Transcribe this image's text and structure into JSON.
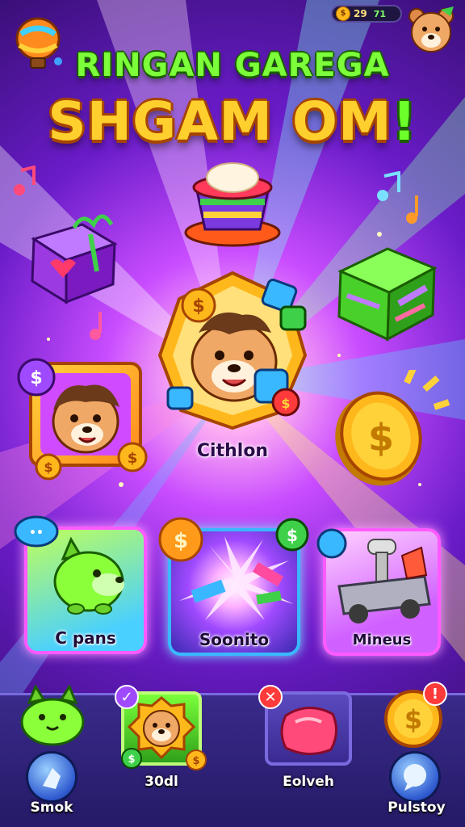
{
  "hud": {
    "coins": "29",
    "gems": "71"
  },
  "title": {
    "line1": "RINGAN GAREGA",
    "line2": "SHGAM OM",
    "line2_end": "!"
  },
  "hero": {
    "label": "Cithlon"
  },
  "cards": [
    {
      "label": "C pans"
    },
    {
      "label": "Soonito"
    },
    {
      "label": "Mineus"
    }
  ],
  "bottom_nav": [
    {
      "label": "Smok"
    },
    {
      "label": "30dl"
    },
    {
      "label": "Eolveh"
    },
    {
      "label": "Pulstoy"
    }
  ],
  "colors": {
    "bg_deep": "#2a0b5e",
    "bg_glow": "#c94dff",
    "title_green": "#7cff3a",
    "title_gold": "#ffcf2e",
    "coin_gold": "#ffb81c"
  }
}
